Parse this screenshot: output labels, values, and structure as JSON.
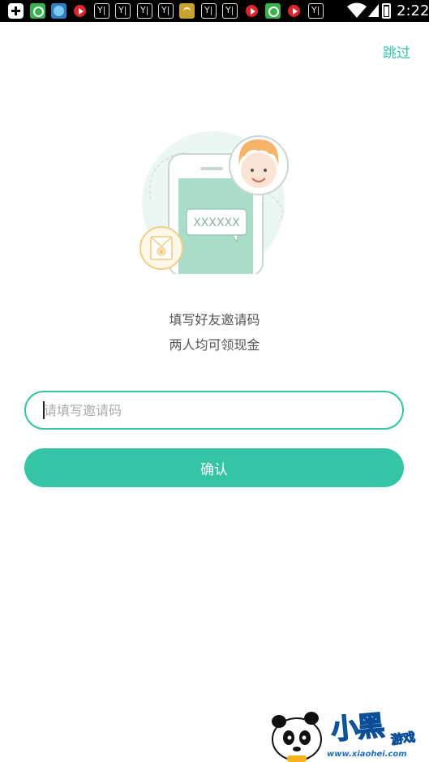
{
  "status_bar": {
    "time": "2:22",
    "icons": [
      "add-icon",
      "wechat-icon",
      "browser-icon",
      "video-icon",
      "y-icon",
      "y-icon",
      "y-icon",
      "y-icon",
      "gold-app-icon",
      "y-icon",
      "y-icon",
      "video-icon",
      "wechat-icon",
      "video-icon",
      "y-icon",
      "wifi-icon",
      "signal-icon",
      "battery-icon"
    ]
  },
  "header": {
    "skip_label": "跳过"
  },
  "illustration": {
    "code_placeholder": "XXXXXX",
    "coin_symbol": "¥"
  },
  "intro": {
    "line1": "填写好友邀请码",
    "line2": "两人均可领现金"
  },
  "form": {
    "invite_input_placeholder": "请填写邀请码",
    "invite_input_value": "",
    "confirm_label": "确认"
  },
  "watermark": {
    "brand": "小黑",
    "sub": "游戏",
    "site": "www.xiaohei.com"
  },
  "colors": {
    "accent": "#36c4a6",
    "status_bar": "#000000",
    "text": "#555555"
  }
}
